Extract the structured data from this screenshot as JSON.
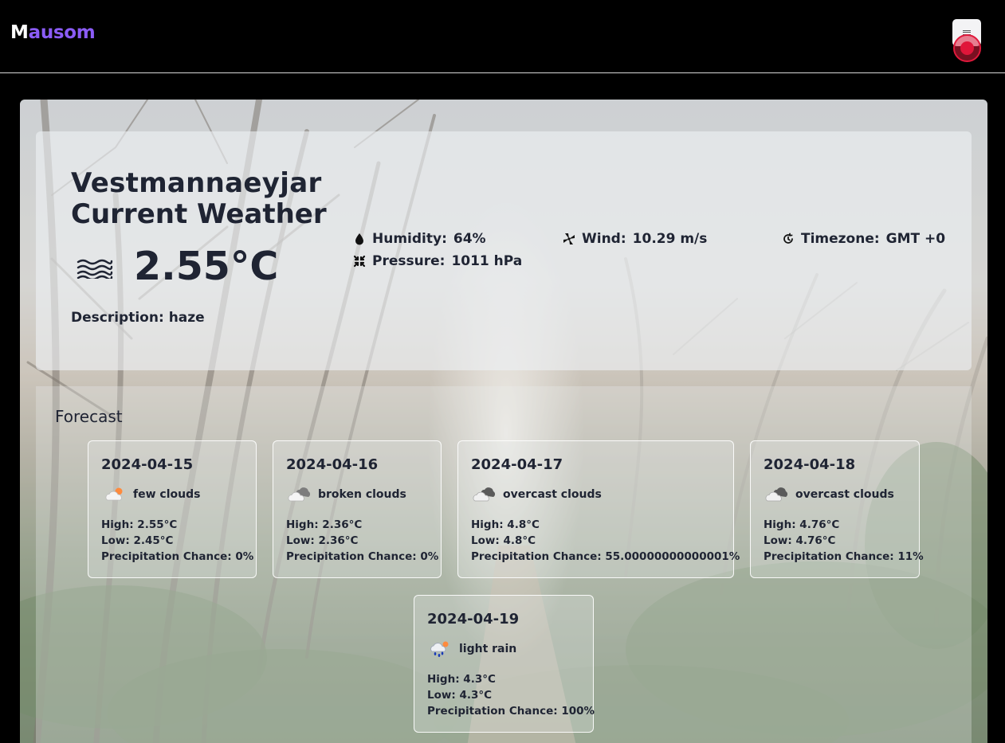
{
  "app": {
    "logo_first": "M",
    "logo_rest": "ausom"
  },
  "header": {
    "menu_icon": "hamburger-icon",
    "record_icon": "record-indicator-icon"
  },
  "current": {
    "city": "Vestmannaeyjar",
    "title": "Current Weather",
    "temperature": "2.55°C",
    "condition_icon": "haze-icon",
    "description_label": "Description:",
    "description_value": "haze",
    "humidity_label": "Humidity:",
    "humidity_value": "64%",
    "pressure_label": "Pressure:",
    "pressure_value": "1011 hPa",
    "wind_label": "Wind:",
    "wind_value": "10.29 m/s",
    "timezone_label": "Timezone:",
    "timezone_value": "GMT +0"
  },
  "forecast": {
    "title": "Forecast",
    "days": [
      {
        "date": "2024-04-15",
        "icon": "few-clouds-icon",
        "condition": "few clouds",
        "high": "High: 2.55°C",
        "low": "Low: 2.45°C",
        "precip": "Precipitation Chance: 0%"
      },
      {
        "date": "2024-04-16",
        "icon": "broken-clouds-icon",
        "condition": "broken clouds",
        "high": "High: 2.36°C",
        "low": "Low: 2.36°C",
        "precip": "Precipitation Chance: 0%"
      },
      {
        "date": "2024-04-17",
        "icon": "overcast-clouds-icon",
        "condition": "overcast clouds",
        "high": "High: 4.8°C",
        "low": "Low: 4.8°C",
        "precip": "Precipitation Chance: 55.00000000000001%"
      },
      {
        "date": "2024-04-18",
        "icon": "overcast-clouds-icon",
        "condition": "overcast clouds",
        "high": "High: 4.76°C",
        "low": "Low: 4.76°C",
        "precip": "Precipitation Chance: 11%"
      },
      {
        "date": "2024-04-19",
        "icon": "light-rain-icon",
        "condition": "light rain",
        "high": "High: 4.3°C",
        "low": "Low: 4.3°C",
        "precip": "Precipitation Chance: 100%"
      }
    ]
  },
  "colors": {
    "accent": "#8b5cf6",
    "text": "#1f2433",
    "header_bg": "#000000",
    "record": "#e0163a"
  }
}
